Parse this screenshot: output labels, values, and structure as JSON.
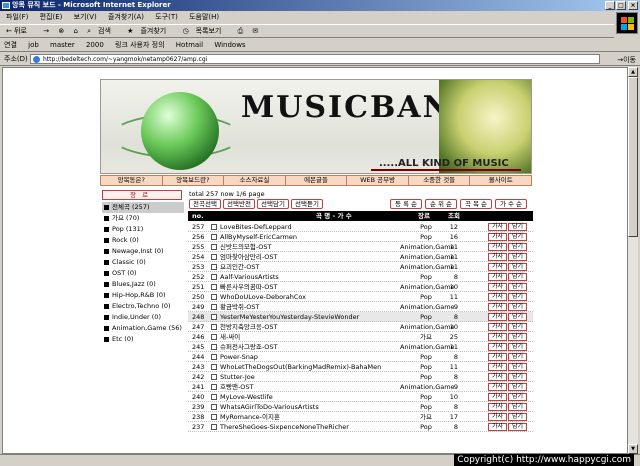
{
  "window": {
    "title": "앙목 뮤직 보드 - Microsoft Internet Explorer"
  },
  "menu": [
    "파일(F)",
    "편집(E)",
    "보기(V)",
    "즐겨찾기(A)",
    "도구(T)",
    "도움말(H)"
  ],
  "toolbar": [
    "뒤로",
    "→",
    "⊗",
    "⌂",
    "검색",
    "즐겨찾기",
    "목록보기"
  ],
  "links": {
    "label": "연결",
    "items": [
      "job",
      "master",
      "2000",
      "링크 사용자 정의",
      "Hotmail",
      "Windows"
    ]
  },
  "address": {
    "label": "주소(D)",
    "url": "http://bedeltech.com/~yangmok/netamp0627/amp.cgi",
    "go": "이동"
  },
  "banner": {
    "title": "MUSICBANK",
    "subtitle": ".....ALL KIND OF MUSIC"
  },
  "nav": [
    "앙목동은?",
    "앙목보드란?",
    "소스자료실",
    "에몬글들",
    "WEB 공부방",
    "소중한 것들",
    "몰사이트"
  ],
  "sidebar": {
    "button": "장르",
    "genres": [
      {
        "label": "전체곡 (257)",
        "selected": true
      },
      {
        "label": "가요 (70)"
      },
      {
        "label": "Pop (131)"
      },
      {
        "label": "Rock (0)"
      },
      {
        "label": "Newage,Inst (0)"
      },
      {
        "label": "Classic (0)"
      },
      {
        "label": "OST (0)"
      },
      {
        "label": "Blues,Jazz (0)"
      },
      {
        "label": "Hip-Hop,R&B (0)"
      },
      {
        "label": "Electro,Techno (0)"
      },
      {
        "label": "Indie,Under (0)"
      },
      {
        "label": "Animation,Game (56)"
      },
      {
        "label": "Etc (0)"
      }
    ]
  },
  "list": {
    "summary": "total 257 now 1/6 page",
    "actions": [
      "전곡선택",
      "선택반전",
      "선택담기",
      "선택듣기"
    ],
    "sorts": [
      "등 록 순",
      "순 위 순",
      "곡 목 순",
      "가 수 순"
    ],
    "headers": {
      "no": "no.",
      "title": "곡 명 - 가 수",
      "genre": "장르",
      "views": "조회"
    },
    "row_buttons": {
      "lyrics": "가사",
      "add": "담기"
    },
    "rows": [
      {
        "no": "257",
        "title": "LoveBites-DefLeppard",
        "genre": "Pop",
        "views": "12"
      },
      {
        "no": "256",
        "title": "AllByMyself-EricCarmen",
        "genre": "Pop",
        "views": "16"
      },
      {
        "no": "255",
        "title": "신밧드의모험-OST",
        "genre": "Animation,Game",
        "views": "11"
      },
      {
        "no": "254",
        "title": "엄마찾아삼만리-OST",
        "genre": "Animation,Game",
        "views": "11"
      },
      {
        "no": "253",
        "title": "요괴인간-OST",
        "genre": "Animation,Game",
        "views": "11"
      },
      {
        "no": "252",
        "title": "Aalf-VariousArtists",
        "genre": "Pop",
        "views": "8"
      },
      {
        "no": "251",
        "title": "빠른사우의꿈따-OST",
        "genre": "Animation,Game",
        "views": "10"
      },
      {
        "no": "250",
        "title": "WhoDoULove-DeborahCox",
        "genre": "Pop",
        "views": "11"
      },
      {
        "no": "249",
        "title": "황금박쥐-OST",
        "genre": "Animation,Game",
        "views": "9"
      },
      {
        "no": "248",
        "title": "YesterMeYesterYouYesterday-StevieWonder",
        "genre": "Pop",
        "views": "8",
        "hl": true
      },
      {
        "no": "247",
        "title": "천방지축앙크응-OST",
        "genre": "Animation,Game",
        "views": "10"
      },
      {
        "no": "246",
        "title": "새-싸이",
        "genre": "가요",
        "views": "25"
      },
      {
        "no": "245",
        "title": "슈퍼전사그랑죠-OST",
        "genre": "Animation,Game",
        "views": "11"
      },
      {
        "no": "244",
        "title": "Power-Snap",
        "genre": "Pop",
        "views": "8"
      },
      {
        "no": "243",
        "title": "WhoLetTheDogsOut(BarkingMadRemix)-BahaMen",
        "genre": "Pop",
        "views": "11"
      },
      {
        "no": "242",
        "title": "Stutter-Joe",
        "genre": "Pop",
        "views": "8"
      },
      {
        "no": "241",
        "title": "호빵맨-OST",
        "genre": "Animation,Game",
        "views": "9"
      },
      {
        "no": "240",
        "title": "MyLove-Westlife",
        "genre": "Pop",
        "views": "10"
      },
      {
        "no": "239",
        "title": "WhatsAGirlToDo-VariousArtists",
        "genre": "Pop",
        "views": "8"
      },
      {
        "no": "238",
        "title": "MyRomance-이지훈",
        "genre": "가요",
        "views": "17"
      },
      {
        "no": "237",
        "title": "ThereSheGoes-SixpenceNoneTheRicher",
        "genre": "Pop",
        "views": "8"
      }
    ]
  },
  "status": {
    "copyright": "Copyright(c) http://www.happycgi.com"
  }
}
